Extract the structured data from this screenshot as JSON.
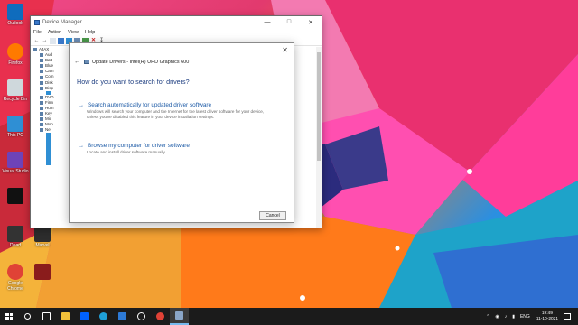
{
  "desktop": {
    "icons": [
      {
        "label": "Outlook",
        "color": "#0f6cbd"
      },
      {
        "label": "Firefox",
        "color": "#ff7a00"
      },
      {
        "label": "Recycle Bin",
        "color": "#cfd8dc"
      },
      {
        "label": "This PC",
        "color": "#2f8fd4"
      },
      {
        "label": "Visual Studio",
        "color": "#6e43b8"
      },
      {
        "label": "Dead",
        "color": "#333333"
      },
      {
        "label": "Marvel",
        "color": "#2d2d2d"
      },
      {
        "label": "Google Chrome",
        "color": "#e04236"
      }
    ]
  },
  "device_manager": {
    "title": "Device Manager",
    "menu": [
      "File",
      "Action",
      "View",
      "Help"
    ],
    "tree": {
      "root": "AJAX",
      "items": [
        "Aud",
        "Batt",
        "Blue",
        "Cam",
        "Com",
        "Disk",
        "Disp",
        "DVD",
        "Firm",
        "Hum",
        "Key",
        "Mic",
        "Mon",
        "Net"
      ]
    }
  },
  "update_drivers": {
    "header": "Update Drivers - Intel(R) UHD Graphics 600",
    "question": "How do you want to search for drivers?",
    "option_auto": {
      "title": "Search automatically for updated driver software",
      "description": "Windows will search your computer and the Internet for the latest driver software for your device, unless you've disabled this feature in your device installation settings."
    },
    "option_browse": {
      "title": "Browse my computer for driver software",
      "description": "Locate and install driver software manually."
    },
    "cancel_label": "Cancel"
  },
  "taskbar": {
    "language": "ENG",
    "time": "19:49",
    "date": "11-10-2021"
  }
}
